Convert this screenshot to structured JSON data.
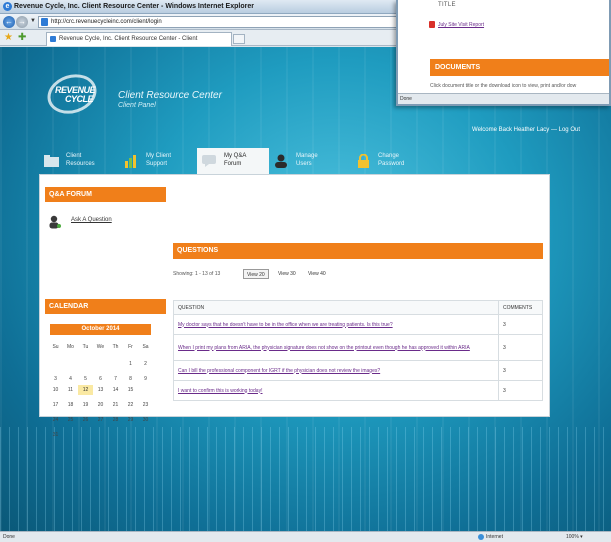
{
  "browser": {
    "title": "Revenue Cycle, Inc. Client Resource Center - Windows Internet Explorer",
    "url": "http://crc.revenuecycleinc.com/client/login",
    "tab_title": "Revenue Cycle, Inc. Client Resource Center - Client",
    "status_left": "Done",
    "status_zone": "Internet",
    "status_zoom": "100%"
  },
  "header": {
    "logo_line1": "REVENUE",
    "logo_line2": "CYCLE",
    "title": "Client Resource Center",
    "subtitle": "Client Panel",
    "welcome": "Welcome Back Heather Lacy — Log Out"
  },
  "nav": {
    "tabs": [
      {
        "line1": "Client",
        "line2": "Resources"
      },
      {
        "line1": "My Client",
        "line2": "Support"
      },
      {
        "line1": "My Q&A",
        "line2": "Forum"
      },
      {
        "line1": "Manage",
        "line2": "Users"
      },
      {
        "line1": "Change",
        "line2": "Password"
      }
    ]
  },
  "sidebar": {
    "forum_heading": "Q&A FORUM",
    "ask_link": "Ask A Question",
    "calendar_heading": "CALENDAR",
    "month": "October 2014",
    "weekdays": [
      "Su",
      "Mo",
      "Tu",
      "We",
      "Th",
      "Fr",
      "Sa"
    ],
    "week1": [
      "",
      "",
      "",
      "",
      "",
      "1",
      "2"
    ],
    "week2": [
      "3",
      "4",
      "5",
      "6",
      "7",
      "8",
      "9"
    ],
    "week3": [
      "10",
      "11",
      "12",
      "13",
      "14",
      "15",
      ""
    ],
    "week4": [
      "17",
      "18",
      "19",
      "20",
      "21",
      "22",
      "23"
    ],
    "week5": [
      "24",
      "25",
      "26",
      "27",
      "28",
      "29",
      "30"
    ],
    "week6": [
      "31",
      "",
      "",
      "",
      "",
      "",
      ""
    ],
    "highlight_day": "12"
  },
  "main": {
    "heading": "QUESTIONS",
    "showing": "Showing: 1 - 13 of 13",
    "view_options": [
      "View 20",
      "View 30",
      "View 40"
    ],
    "columns": [
      "QUESTION",
      "COMMENTS"
    ],
    "rows": [
      {
        "question": "My doctor says that he doesn't have to be in the office when we are treating patients. Is this true?",
        "comments": "3"
      },
      {
        "question": "When I print my plans from ARIA, the physician signature does not show on the printout even though he has approved it within ARIA",
        "comments": "3"
      },
      {
        "question": "Can I bill the professional component for IGRT if the physician does not review the images?",
        "comments": "3"
      },
      {
        "question": "I want to confirm this is working today!",
        "comments": "3"
      }
    ]
  },
  "popup": {
    "column_title": "TITLE",
    "report_link": "July Site Visit Report",
    "documents_heading": "DOCUMENTS",
    "hint": "Click document title or the download icon to view, print and/or dow",
    "status": "Done"
  },
  "colors": {
    "accent_orange": "#f07f1a",
    "link_purple": "#6a2b8a",
    "bg_teal": "#1f9cc0"
  }
}
